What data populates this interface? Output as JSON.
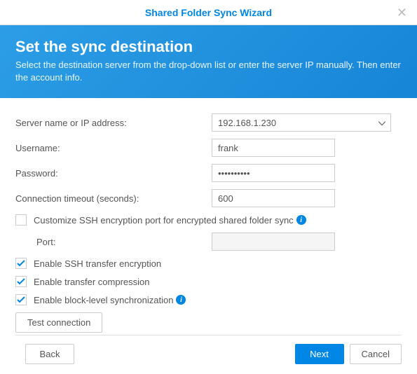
{
  "window": {
    "title": "Shared Folder Sync Wizard"
  },
  "banner": {
    "heading": "Set the sync destination",
    "sub": "Select the destination server from the drop-down list or enter the server IP manually. Then enter the account info."
  },
  "fields": {
    "server_label": "Server name or IP address:",
    "server_value": "192.168.1.230",
    "username_label": "Username:",
    "username_value": "frank",
    "password_label": "Password:",
    "password_value": "••••••••••",
    "timeout_label": "Connection timeout (seconds):",
    "timeout_value": "600",
    "port_label": "Port:",
    "port_value": ""
  },
  "options": {
    "custom_ssh_port": {
      "checked": false,
      "label": "Customize SSH encryption port for encrypted shared folder sync"
    },
    "ssh_encrypt": {
      "checked": true,
      "label": "Enable SSH transfer encryption"
    },
    "compression": {
      "checked": true,
      "label": "Enable transfer compression"
    },
    "block_level": {
      "checked": true,
      "label": "Enable block-level synchronization"
    }
  },
  "buttons": {
    "test": "Test connection",
    "back": "Back",
    "next": "Next",
    "cancel": "Cancel"
  }
}
